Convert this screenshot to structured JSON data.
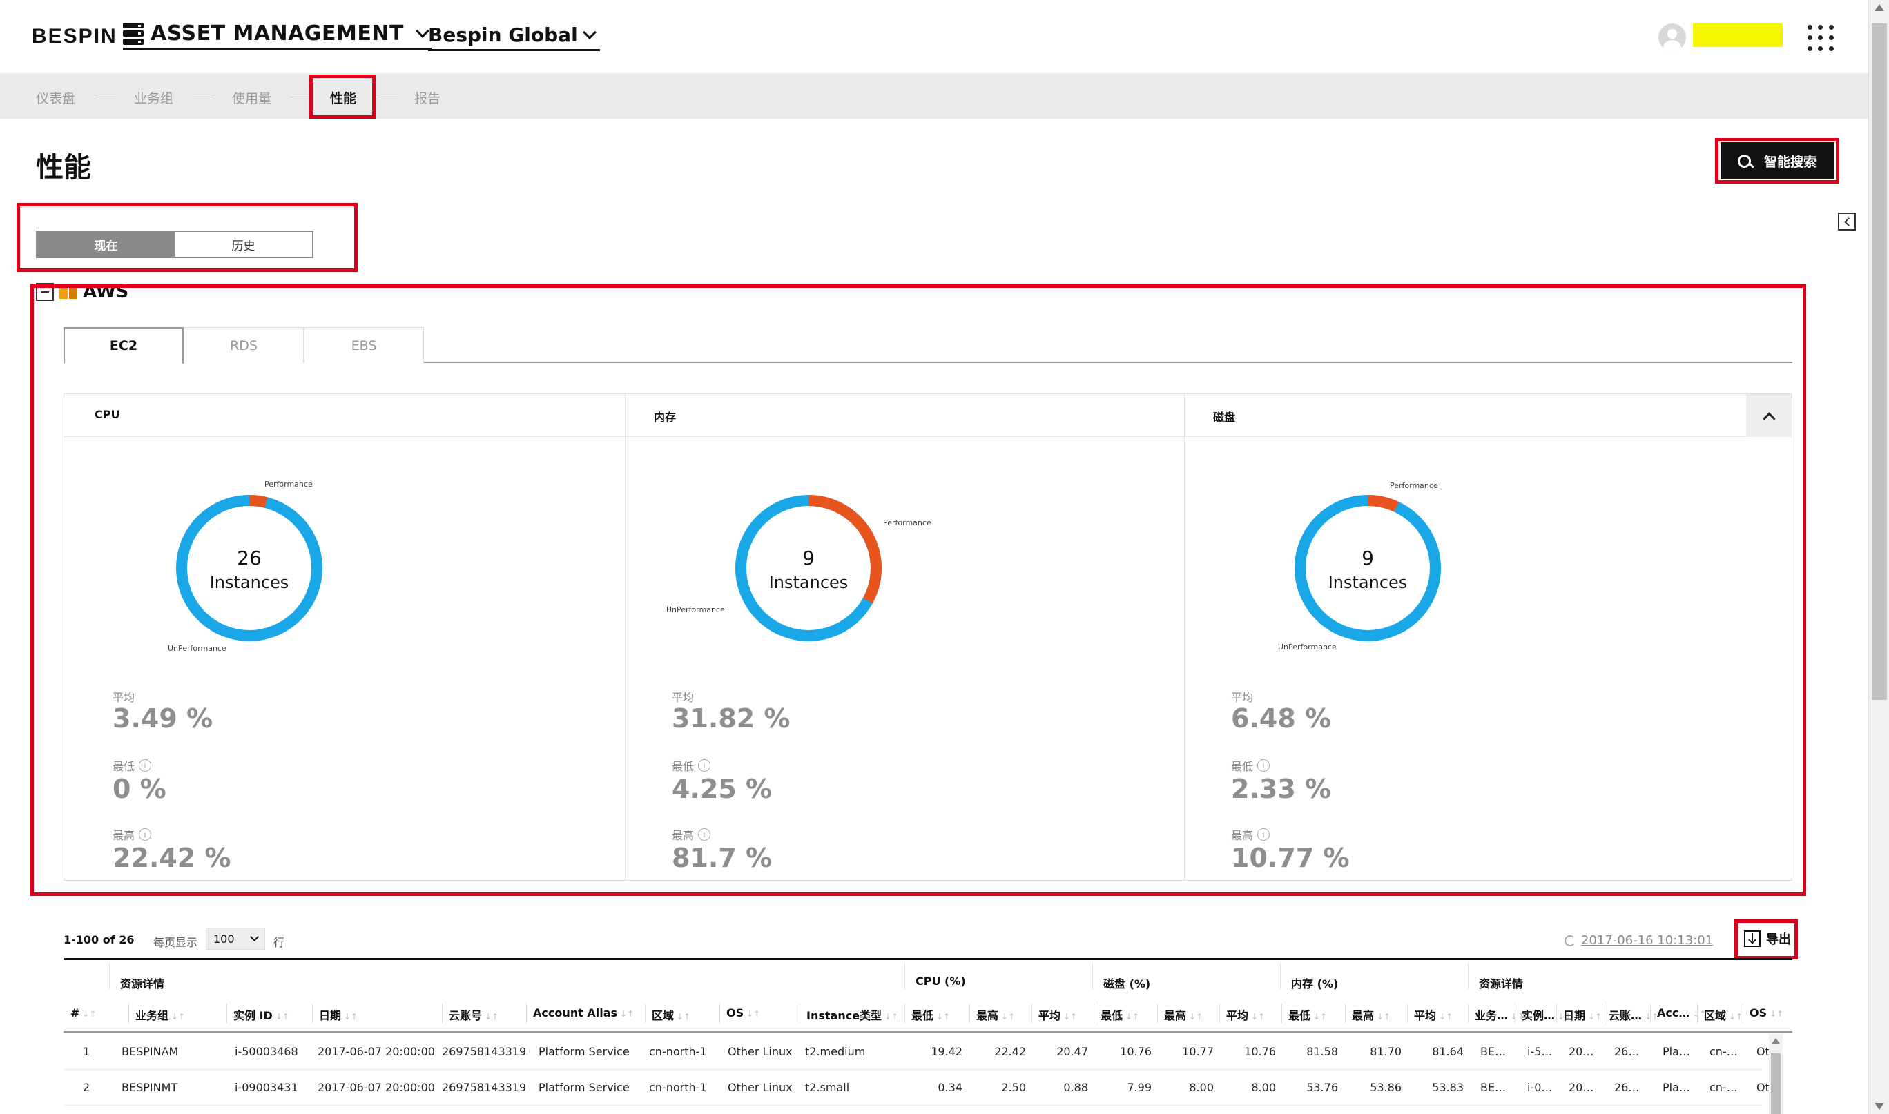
{
  "header": {
    "logo": "BESPIN",
    "app_name": "ASSET MANAGEMENT",
    "org_name": "Bespin Global"
  },
  "breadcrumb": [
    "仪表盘",
    "业务组",
    "使用量",
    "性能",
    "报告"
  ],
  "breadcrumb_active": "性能",
  "page_title": "性能",
  "smart_search_label": "智能搜索",
  "view_toggle": {
    "current": "现在",
    "history": "历史",
    "selected": "现在"
  },
  "provider": "AWS",
  "tabs": [
    "EC2",
    "RDS",
    "EBS"
  ],
  "tab_active": "EC2",
  "colors": {
    "donut_main": "#1aa7e8",
    "donut_highlight": "#e8541e",
    "highlight_box": "#e0001b",
    "user_name_mask": "#f5f500"
  },
  "metrics": [
    {
      "title": "CPU",
      "count": "26",
      "unit": "Instances",
      "performance_label": "Performance",
      "unperformance_label": "UnPerformance",
      "performance_fraction": 0.04,
      "avg_label": "平均",
      "avg": "3.49 %",
      "min_label": "最低",
      "min": "0 %",
      "max_label": "最高",
      "max": "22.42 %"
    },
    {
      "title": "内存",
      "count": "9",
      "unit": "Instances",
      "performance_label": "Performance",
      "unperformance_label": "UnPerformance",
      "performance_fraction": 0.33,
      "avg_label": "平均",
      "avg": "31.82 %",
      "min_label": "最低",
      "min": "4.25 %",
      "max_label": "最高",
      "max": "81.7 %"
    },
    {
      "title": "磁盘",
      "count": "9",
      "unit": "Instances",
      "performance_label": "Performance",
      "unperformance_label": "UnPerformance",
      "performance_fraction": 0.07,
      "avg_label": "平均",
      "avg": "6.48 %",
      "min_label": "最低",
      "min": "2.33 %",
      "max_label": "最高",
      "max": "10.77 %"
    }
  ],
  "table": {
    "range": "1-100 of 26",
    "per_page_label": "每页显示",
    "per_page_value": "100",
    "rows_label": "行",
    "refresh_time": "2017-06-16 10:13:01",
    "export_label": "导出",
    "groups": [
      "资源详情",
      "CPU (%)",
      "磁盘 (%)",
      "内存 (%)",
      "资源详情"
    ],
    "columns": [
      "#",
      "业务组",
      "实例 ID",
      "日期",
      "云账号",
      "Account Alias",
      "区域",
      "OS",
      "Instance类型",
      "最低",
      "最高",
      "平均",
      "最低",
      "最高",
      "平均",
      "最低",
      "最高",
      "平均",
      "业务…",
      "实例…",
      "日期",
      "云账…",
      "Acc…",
      "区域",
      "OS"
    ],
    "rows": [
      [
        "1",
        "BESPINAM",
        "i-50003468",
        "2017-06-07 20:00:00",
        "269758143319",
        "Platform Service",
        "cn-north-1",
        "Other Linux",
        "t2.medium",
        "19.42",
        "22.42",
        "20.47",
        "10.76",
        "10.77",
        "10.76",
        "81.58",
        "81.70",
        "81.64",
        "BE…",
        "i-5…",
        "20…",
        "26…",
        "Pla…",
        "cn-…",
        "Ot"
      ],
      [
        "2",
        "BESPINMT",
        "i-09003431",
        "2017-06-07 20:00:00",
        "269758143319",
        "Platform Service",
        "cn-north-1",
        "Other Linux",
        "t2.small",
        "0.34",
        "2.50",
        "0.88",
        "7.99",
        "8.00",
        "8.00",
        "53.76",
        "53.86",
        "53.83",
        "BE…",
        "i-0…",
        "20…",
        "26…",
        "Pla…",
        "cn-…",
        "Ot"
      ]
    ]
  }
}
